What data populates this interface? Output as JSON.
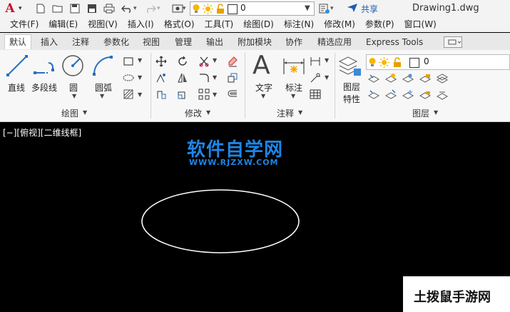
{
  "titlebar": {
    "logo_letter": "A",
    "layer_value": "0",
    "share_label": "共享",
    "document_title": "Drawing1.dwg"
  },
  "menu": [
    "文件(F)",
    "编辑(E)",
    "视图(V)",
    "插入(I)",
    "格式(O)",
    "工具(T)",
    "绘图(D)",
    "标注(N)",
    "修改(M)",
    "参数(P)",
    "窗口(W)"
  ],
  "tabs": [
    "默认",
    "插入",
    "注释",
    "参数化",
    "视图",
    "管理",
    "输出",
    "附加模块",
    "协作",
    "精选应用",
    "Express Tools"
  ],
  "active_tab": "默认",
  "ribbon": {
    "draw": {
      "line": "直线",
      "polyline": "多段线",
      "circle": "圆",
      "arc": "圆弧",
      "title": "绘图"
    },
    "modify": {
      "title": "修改"
    },
    "annotation": {
      "text": "文字",
      "dimension": "标注",
      "title": "注释"
    },
    "layers": {
      "properties_line1": "图层",
      "properties_line2": "特性",
      "current_layer": "0",
      "title": "图层"
    }
  },
  "canvas": {
    "viewport_label": "[−][俯视][二维线框]",
    "watermark_title": "软件自学网",
    "watermark_url": "WWW.RJZXW.COM",
    "corner_watermark": "土拨鼠手游网"
  },
  "colors": {
    "canvas_bg": "#000000",
    "ellipse_stroke": "#ffffff",
    "watermark_blue": "#1d86e8",
    "logo_red": "#c8102e",
    "share_blue": "#1b5db0"
  }
}
